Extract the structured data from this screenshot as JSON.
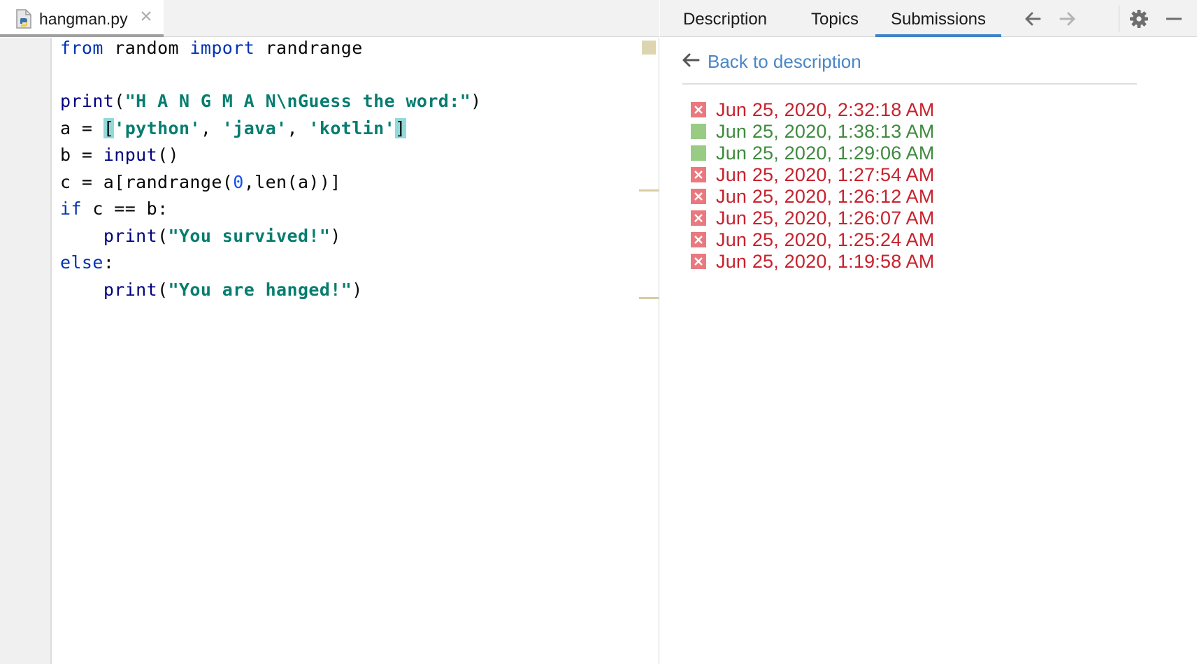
{
  "editor": {
    "tab": {
      "file_name": "hangman.py",
      "icon": "python-file-icon"
    },
    "lines": [
      "from random import randrange",
      "",
      "print(\"H A N G M A N\\nGuess the word:\")",
      "a = ['python', 'java', 'kotlin']",
      "b = input()",
      "c = a[randrange(0,len(a))]",
      "if c == b:",
      "    print(\"You survived!\")",
      "else:",
      "    print(\"You are hanged!\")"
    ]
  },
  "panel": {
    "tabs": [
      {
        "label": "Description",
        "active": false
      },
      {
        "label": "Topics",
        "active": false
      },
      {
        "label": "Submissions",
        "active": true
      }
    ],
    "icons": [
      "arrow-left-icon",
      "arrow-right-icon",
      "gear-icon",
      "minimize-icon"
    ],
    "back_link": "Back to description",
    "submissions": [
      {
        "date": "Jun 25, 2020, 2:32:18 AM",
        "status": "failed"
      },
      {
        "date": "Jun 25, 2020, 1:38:13 AM",
        "status": "passed"
      },
      {
        "date": "Jun 25, 2020, 1:29:06 AM",
        "status": "passed"
      },
      {
        "date": "Jun 25, 2020, 1:27:54 AM",
        "status": "failed"
      },
      {
        "date": "Jun 25, 2020, 1:26:12 AM",
        "status": "failed"
      },
      {
        "date": "Jun 25, 2020, 1:26:07 AM",
        "status": "failed"
      },
      {
        "date": "Jun 25, 2020, 1:25:24 AM",
        "status": "failed"
      },
      {
        "date": "Jun 25, 2020, 1:19:58 AM",
        "status": "failed"
      }
    ]
  },
  "colors": {
    "failed_text": "#c7222d",
    "passed_text": "#3f8a3f",
    "failed_icon": "#e9797f",
    "passed_icon": "#98cc85",
    "link": "#4a86c8",
    "tab_underline": "#4083c9"
  }
}
